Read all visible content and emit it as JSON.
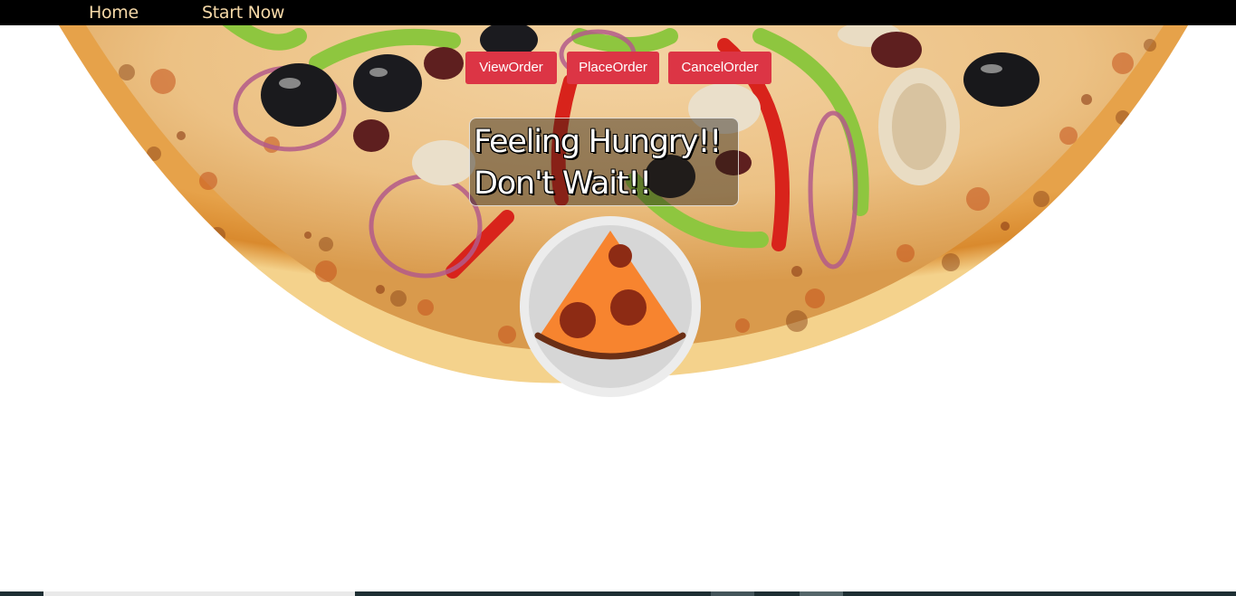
{
  "nav": {
    "home_label": "Home",
    "start_label": "Start Now",
    "link_color": "#f6d9a8"
  },
  "actions": {
    "view_label": "ViewOrder",
    "place_label": "PlaceOrder",
    "cancel_label": "CancelOrder",
    "button_color": "#dc3545"
  },
  "hero": {
    "tagline_line1": "Feeling Hungry!!",
    "tagline_line2": "Don't Wait!!"
  },
  "logo": {
    "icon": "pizza-slice-icon"
  }
}
